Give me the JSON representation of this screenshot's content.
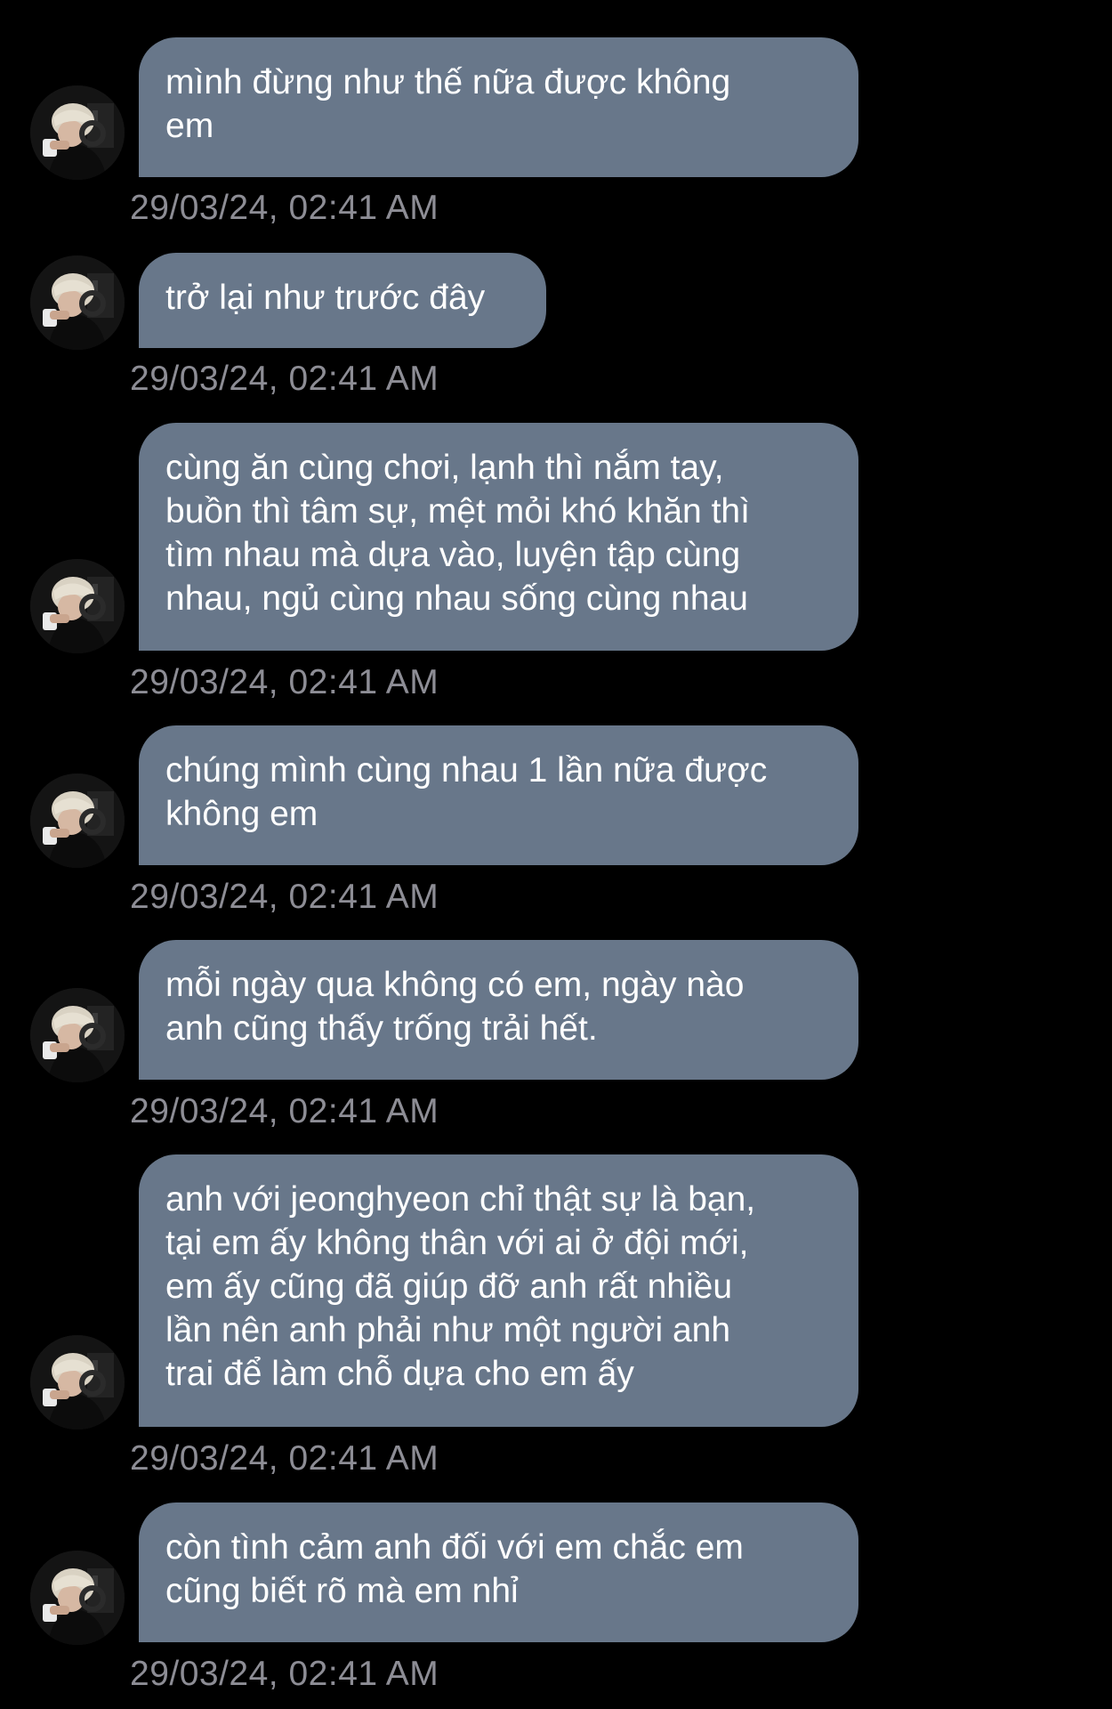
{
  "conversation": {
    "colors": {
      "background": "#000000",
      "bubble": "#68778a",
      "bubble_text": "#ffffff",
      "timestamp": "#8d8d95"
    },
    "messages": [
      {
        "text": "mình đừng như thế nữa được không\nem",
        "time": "29/03/24, 02:41 AM"
      },
      {
        "text": "trở lại như trước đây",
        "time": "29/03/24, 02:41 AM"
      },
      {
        "text": "cùng ăn cùng chơi, lạnh thì nắm tay,\nbuồn thì tâm sự, mệt mỏi khó khăn thì\ntìm nhau mà dựa vào, luyện tập cùng\nnhau, ngủ cùng nhau sống cùng nhau",
        "time": "29/03/24, 02:41 AM"
      },
      {
        "text": "chúng mình cùng nhau 1 lần nữa được\nkhông em",
        "time": "29/03/24, 02:41 AM"
      },
      {
        "text": "mỗi ngày qua không có em, ngày nào\nanh cũng thấy trống trải hết.",
        "time": "29/03/24, 02:41 AM"
      },
      {
        "text": "anh với jeonghyeon chỉ thật sự là bạn,\ntại em ấy không thân với ai ở đội mới,\nem ấy cũng đã giúp đỡ anh rất nhiều\nlần nên anh phải như một người anh\ntrai để làm chỗ dựa cho em ấy",
        "time": "29/03/24, 02:41 AM"
      },
      {
        "text": "còn tình cảm anh đối với em chắc em\ncũng biết rõ mà em nhỉ",
        "time": "29/03/24, 02:41 AM"
      }
    ]
  }
}
